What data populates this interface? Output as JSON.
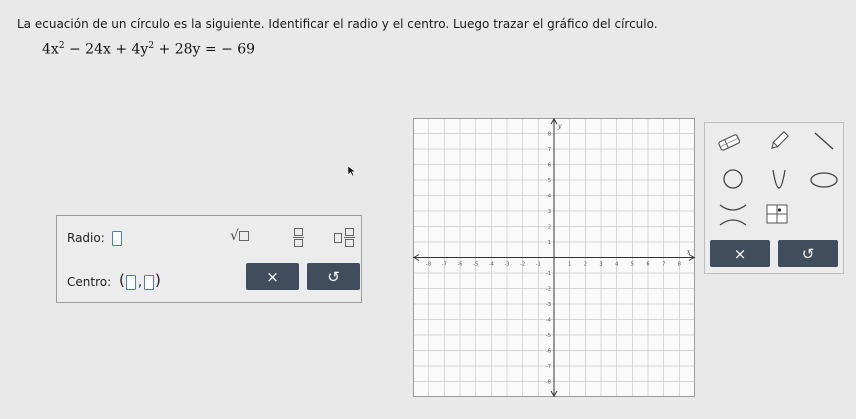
{
  "prompt": "La ecuación de un círculo es la siguiente. Identificar el radio y el centro. Luego trazar el gráfico del círculo.",
  "equation": {
    "t1": "4x",
    "e1": "2",
    "t2": " − 24x + 4y",
    "e2": "2",
    "t3": " + 28y = − 69"
  },
  "answer": {
    "radius_label": "Radio:",
    "center_label": "Centro:",
    "center_open": "(",
    "center_comma": ",",
    "center_close": ")"
  },
  "keypad": {
    "sqrt_symbol": "√",
    "clear_symbol": "×",
    "undo_symbol": "↺"
  },
  "graph": {
    "x_range": [
      -9,
      9
    ],
    "y_range": [
      -9,
      9
    ],
    "x_axis_label": "x",
    "y_axis_label": "y",
    "tick_labels": {
      "x": [
        "-8",
        "-7",
        "-6",
        "-5",
        "-4",
        "-3",
        "-2",
        "-1",
        "1",
        "2",
        "3",
        "4",
        "5",
        "6",
        "7",
        "8"
      ],
      "y": [
        "8",
        "7",
        "6",
        "5",
        "4",
        "3",
        "2",
        "1",
        "-1",
        "-2",
        "-3",
        "-4",
        "-5",
        "-6",
        "-7",
        "-8"
      ]
    }
  },
  "tools": {
    "clear_symbol": "×",
    "undo_symbol": "↺",
    "items": [
      "eraser-icon",
      "pencil-icon",
      "line-segment-icon",
      "circle-icon",
      "parabola-icon",
      "ellipse-icon",
      "hyperbola-icon",
      "point-grid-icon"
    ]
  },
  "colors": {
    "button_dark": "#3f4d5c",
    "input_border": "#4a7bc9",
    "grid_line": "#c9c9c9",
    "background": "#e9e9e9"
  }
}
